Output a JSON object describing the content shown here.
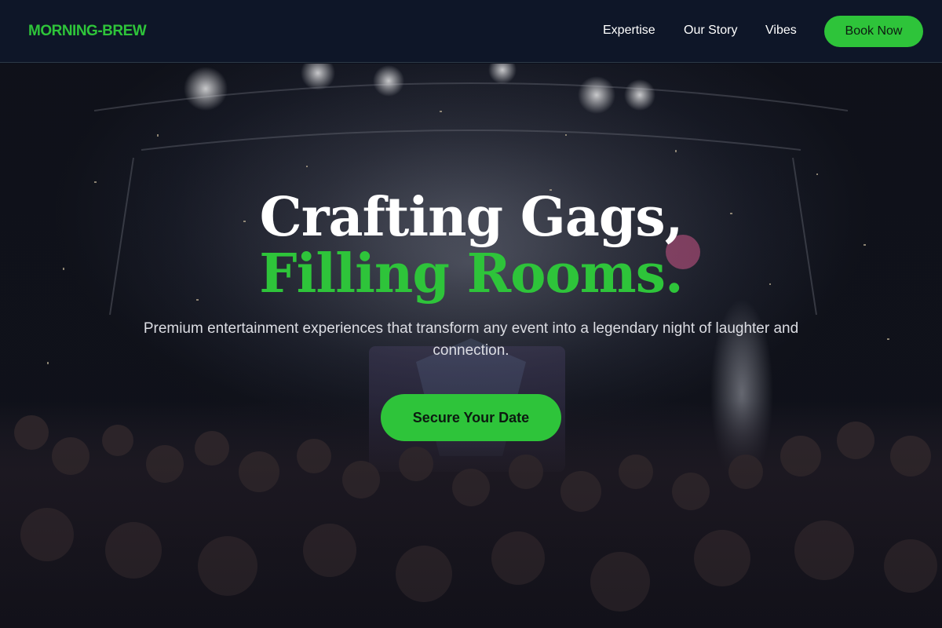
{
  "header": {
    "logo": "MORNING-BREW",
    "nav": {
      "expertise": "Expertise",
      "our_story": "Our Story",
      "vibes": "Vibes"
    },
    "cta_label": "Book Now"
  },
  "hero": {
    "headline_line1": "Crafting Gags,",
    "headline_line2": "Filling Rooms.",
    "subtitle": "Premium entertainment experiences that transform any event into a legendary night of laughter and connection.",
    "cta_label": "Secure Your Date",
    "background_image": "concert-crowd-confetti-photo"
  },
  "colors": {
    "accent": "#2ec43a",
    "header_bg": "#0e1628",
    "text_light": "#ffffff"
  }
}
